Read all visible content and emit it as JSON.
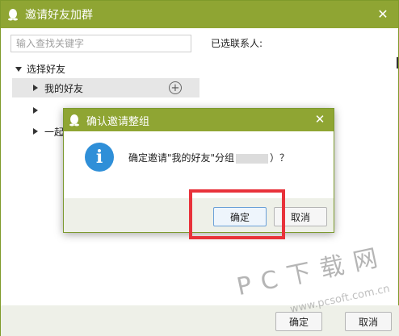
{
  "main_window": {
    "title": "邀请好友加群",
    "search": {
      "placeholder": "输入查找关键字",
      "value": ""
    },
    "tree": {
      "root_label": "选择好友",
      "groups": [
        {
          "label": "我的好友",
          "selected": true
        },
        {
          "label": "",
          "selected": false
        },
        {
          "label": "一起",
          "selected": false
        }
      ]
    },
    "selected_contacts_label": "已选联系人:",
    "footer": {
      "confirm_label": "确定",
      "cancel_label": "取消"
    }
  },
  "dialog": {
    "title": "确认邀请整组",
    "message_prefix": "确定邀请\"我的好友\"分组",
    "message_suffix": "）？",
    "confirm_label": "确定",
    "cancel_label": "取消"
  },
  "watermark": {
    "text": "PC下载网",
    "url": "www.pcsoft.com.cn"
  },
  "colors": {
    "titlebar": "#8fa533",
    "info_icon": "#2f8fd8",
    "highlight": "#e8323a"
  }
}
